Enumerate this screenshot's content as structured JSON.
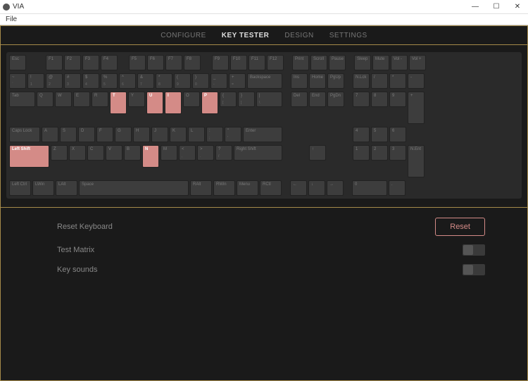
{
  "window": {
    "title": "VIA",
    "min": "—",
    "max": "☐",
    "close": "✕"
  },
  "menubar": {
    "file": "File"
  },
  "tabs": {
    "configure": "CONFIGURE",
    "keytester": "KEY TESTER",
    "design": "DESIGN",
    "settings": "SETTINGS"
  },
  "pressed_keys": [
    "T",
    "U",
    "I",
    "P",
    "N",
    "Left Shift"
  ],
  "keys": {
    "esc": "Esc",
    "f1": "F1",
    "f2": "F2",
    "f3": "F3",
    "f4": "F4",
    "f5": "F5",
    "f6": "F6",
    "f7": "F7",
    "f8": "F8",
    "f9": "F9",
    "f10": "F10",
    "f11": "F11",
    "f12": "F12",
    "print": "Print",
    "scroll": "Scroll",
    "pause": "Pause",
    "sleep": "Sleep",
    "mute": "Mute",
    "voldn": "Vol -",
    "volup": "Vol +",
    "tilde_top": "~",
    "tilde_bot": "`",
    "n1t": "!",
    "n1b": "1",
    "n2t": "@",
    "n2b": "2",
    "n3t": "#",
    "n3b": "3",
    "n4t": "$",
    "n4b": "4",
    "n5t": "%",
    "n5b": "5",
    "n6t": "^",
    "n6b": "6",
    "n7t": "&",
    "n7b": "7",
    "n8t": "*",
    "n8b": "8",
    "n9t": "(",
    "n9b": "9",
    "n0t": ")",
    "n0b": "0",
    "mint": "_",
    "minb": "-",
    "eqt": "+",
    "eqb": "=",
    "bksp": "Backspace",
    "ins": "Ins",
    "home": "Home",
    "pgup": "PgUp",
    "nlck": "N.Lck",
    "npdiv": "/",
    "npmul": "*",
    "npmin": "-",
    "tab": "Tab",
    "q": "Q",
    "w": "W",
    "e": "E",
    "r": "R",
    "t": "T",
    "y": "Y",
    "u": "U",
    "i": "I",
    "o": "O",
    "p": "P",
    "lbrt": "{",
    "lbrb": "[",
    "rbrt": "}",
    "rbrb": "]",
    "bslt": "|",
    "bslb": "\\",
    "del": "Del",
    "end": "End",
    "pgdn": "PgDn",
    "np7": "7",
    "np8": "8",
    "np9": "9",
    "npplus": "+",
    "caps": "Caps Lock",
    "a": "A",
    "s": "S",
    "d": "D",
    "f": "F",
    "g": "G",
    "h": "H",
    "j": "J",
    "k": "K",
    "l": "L",
    "semit": ":",
    "semib": ";",
    "quott": "\"",
    "quotb": "'",
    "enter": "Enter",
    "np4": "4",
    "np5": "5",
    "np6": "6",
    "lshift": "Left Shift",
    "z": "Z",
    "x": "X",
    "c": "C",
    "v": "V",
    "b": "B",
    "n": "N",
    "m": "M",
    "commt": "<",
    "commb": ",",
    "pert": ">",
    "perb": ".",
    "slt": "?",
    "slb": "/",
    "rshift": "Right Shift",
    "up": "↑",
    "np1": "1",
    "np2": "2",
    "np3": "3",
    "npent": "N.Ent",
    "lctrl": "Left Ctrl",
    "lwin": "LWin",
    "lalt": "LAlt",
    "space": "Space",
    "ralt": "RAlt",
    "rwin": "RWin",
    "menu": "Menu",
    "rctrl": "RCtl",
    "left": "←",
    "down": "↓",
    "right": "→",
    "np0": "0",
    "npdot": "."
  },
  "options": {
    "reset_label": "Reset Keyboard",
    "reset_btn": "Reset",
    "test_matrix": "Test Matrix",
    "key_sounds": "Key sounds"
  }
}
